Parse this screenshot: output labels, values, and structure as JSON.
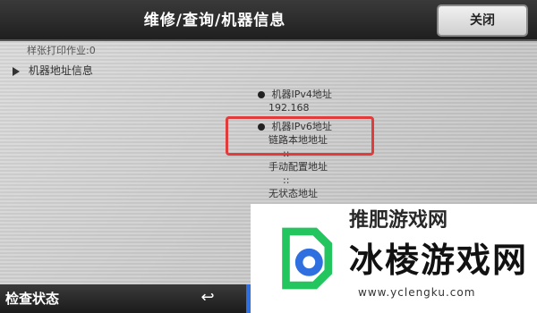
{
  "header": {
    "title": "维修/查询/机器信息",
    "close_label": "关闭"
  },
  "content": {
    "counter_text": "样张打印作业:0",
    "section_label": "机器地址信息",
    "ipv4": {
      "label": "机器IPv4地址",
      "value": "192.168"
    },
    "ipv6": {
      "label": "机器IPv6地址",
      "link_local_label": "链路本地地址",
      "link_local_value": "::",
      "manual_label": "手动配置地址",
      "manual_value": "::",
      "stateless_label": "无状态地址",
      "stateless_value_1": "::",
      "stateless_value_2": "::"
    }
  },
  "footer": {
    "status_label": "检查状态",
    "back_icon": "↩"
  },
  "overlay": {
    "top_text": "推肥游戏网",
    "title": "冰棱游戏网",
    "url": "www.yclengku.com",
    "accent": "#2f6fe0",
    "green": "#22c55e"
  }
}
